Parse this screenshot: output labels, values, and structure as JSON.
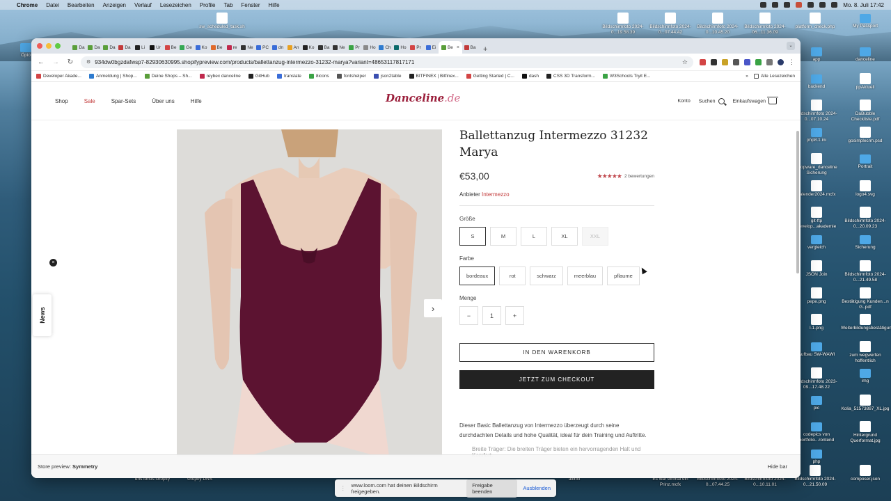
{
  "menubar": {
    "app": "Chrome",
    "items": [
      "Datei",
      "Bearbeiten",
      "Anzeigen",
      "Verlauf",
      "Lesezeichen",
      "Profile",
      "Tab",
      "Fenster",
      "Hilfe"
    ],
    "clock": "Mo. 8. Juli  17:42"
  },
  "desktop": {
    "top_icons": [
      "sw_scheduled_task.sh",
      "Bildschirmfoto 2024-0...19.58.39",
      "Bildschirmfoto 2024-0...07.44.42",
      "Bildschirmfoto 2024-0...10.45.20",
      "Bildschirmfoto 2024-06...11.36.09",
      "platform_check.php",
      "My Passport"
    ],
    "right_icons": [
      "app",
      "danceline",
      "backend",
      "ppAktuell",
      "Bildschirmfoto 2024-0...07.10.24",
      "DaBubble Checkliste.pdf",
      "php8.1.ini",
      "gosimplecrm.psd",
      "shopware_danceline Sicherung",
      "Portrait",
      "kalender2024.mcfx",
      "logo4.svg",
      "git-ftp develop...akademie",
      "Bildschirmfoto 2024-0...20.09.23",
      "vergleich",
      "Sicherung",
      "JSON Join",
      "Bildschirmfoto 2024-0...21.49.58",
      "pepe.png",
      "Bestätigung Kunden...n G..pdf",
      "l-1.png",
      "Weiterbildungsbestätigung...giew.pdf",
      "Aufbau SW-WAWI",
      "zum wegwerfen hoffentlich",
      "Bildschirmfoto 2023-09...17.48.22",
      "img",
      "pic",
      "Kolia_51573887_XL.jpg",
      "codepics von portfolio...rontend",
      "Hintergrund Querformat.jpg",
      "php"
    ],
    "bottom_icons": [
      "dns ionos shopify",
      "shopify DNS",
      "allinkl",
      "Es war einmal ein Prinz.mcfx",
      "Bildschirmfoto 2024-0...07.44.25",
      "Bildschirmfoto 2024-0...10.11.01",
      "Bildschirmfoto 2024-0...21.50.09",
      "composer.json"
    ],
    "left_icon": "Öpio"
  },
  "browser": {
    "tabs": [
      {
        "label": "Da",
        "color": "#5a9e3a"
      },
      {
        "label": "Da",
        "color": "#5a9e3a"
      },
      {
        "label": "Da",
        "color": "#5a9e3a"
      },
      {
        "label": "Da",
        "color": "#c23a3a"
      },
      {
        "label": "Li",
        "color": "#222"
      },
      {
        "label": "Ur",
        "color": "#111"
      },
      {
        "label": "Be",
        "color": "#d34545"
      },
      {
        "label": "Ge",
        "color": "#34a853"
      },
      {
        "label": "Ko",
        "color": "#3a6dd8"
      },
      {
        "label": "Be",
        "color": "#e06a2b"
      },
      {
        "label": "re",
        "color": "#c0284c"
      },
      {
        "label": "Ne",
        "color": "#333"
      },
      {
        "label": "PC",
        "color": "#3a6dd8"
      },
      {
        "label": "dn",
        "color": "#3a6dd8"
      },
      {
        "label": "An",
        "color": "#e8a020"
      },
      {
        "label": "Ko",
        "color": "#222"
      },
      {
        "label": "Ba",
        "color": "#333"
      },
      {
        "label": "Ne",
        "color": "#333"
      },
      {
        "label": "Pr",
        "color": "#3aa345"
      },
      {
        "label": "Ho",
        "color": "#8a8a8a"
      },
      {
        "label": "Ch",
        "color": "#2e7bcf"
      },
      {
        "label": "Ho",
        "color": "#0b6a6a"
      },
      {
        "label": "Pr",
        "color": "#d34545"
      },
      {
        "label": "Ei",
        "color": "#3a6dd8"
      },
      {
        "label": "Be",
        "color": "#5a9e3a"
      },
      {
        "label": "Ba",
        "color": "#c23a3a"
      }
    ],
    "active_tab_close": "×",
    "new_tab": "+",
    "url": "934dw0bgzdafwsp7-82930630995.shopifypreview.com/products/ballettanzug-intermezzo-31232-marya?variant=48653117817171",
    "bookmarks": [
      {
        "label": "Developer Akade...",
        "color": "#d34545"
      },
      {
        "label": "Anmeldung | Shop...",
        "color": "#2e7bcf"
      },
      {
        "label": "Deine Shops – Sh...",
        "color": "#5a9e3a"
      },
      {
        "label": "reybex danceline",
        "color": "#c0284c"
      },
      {
        "label": "GitHub",
        "color": "#222"
      },
      {
        "label": "translate",
        "color": "#3a6dd8"
      },
      {
        "label": "8icons",
        "color": "#3aa345"
      },
      {
        "label": "fontshelper",
        "color": "#555"
      },
      {
        "label": "json2table",
        "color": "#3a4fb0"
      },
      {
        "label": "BITFINEX | Bitfinex...",
        "color": "#222"
      },
      {
        "label": "Getting Started | C...",
        "color": "#d34545"
      },
      {
        "label": "dash",
        "color": "#111"
      },
      {
        "label": "CSS 3D Transform...",
        "color": "#222"
      },
      {
        "label": "W3Schools Tryit E...",
        "color": "#3aa345"
      }
    ],
    "bookmarks_more": "»",
    "bookmarks_all": "Alle Lesezeichen"
  },
  "site": {
    "nav": [
      "Shop",
      "Sale",
      "Spar-Sets",
      "Über uns",
      "Hilfe"
    ],
    "logo_main": "Danceline",
    "logo_tld": ".de",
    "account": "Konto",
    "search": "Suchen",
    "cart": "Einkaufswagen",
    "news": "News",
    "news_close": "×"
  },
  "product": {
    "title": "Ballettanzug Intermezzo 31232 Marya",
    "price": "€53,00",
    "stars": "★★★★★",
    "rating": 5,
    "reviews": "2 bewertungen",
    "vendor_label": "Anbieter",
    "vendor": "Intermezzo",
    "size_label": "Größe",
    "sizes": [
      "S",
      "M",
      "L",
      "XL",
      "XXL"
    ],
    "color_label": "Farbe",
    "colors": [
      "bordeaux",
      "rot",
      "schwarz",
      "meerblau",
      "pflaume"
    ],
    "qty_label": "Menge",
    "qty": "1",
    "minus": "−",
    "plus": "+",
    "add_to_cart": "IN DEN WARENKORB",
    "checkout": "JETZT ZUM CHECKOUT",
    "description": "Dieser Basic Ballettanzug von Intermezzo überzeugt durch seine durchdachten Details und hohe Qualität, ideal für dein Training und Auftritte.",
    "desc_item": "Breite Träger: Die breiten Träger bieten ein hervorragenden Halt und Komfort.",
    "next_arrow": "›"
  },
  "preview_bar": {
    "label": "Store preview:",
    "theme": "Symmetry",
    "hide": "Hide bar"
  },
  "loom": {
    "message": "www.loom.com hat deinen Bildschirm freigegeben.",
    "stop": "Freigabe beenden",
    "hide": "Ausblenden"
  }
}
